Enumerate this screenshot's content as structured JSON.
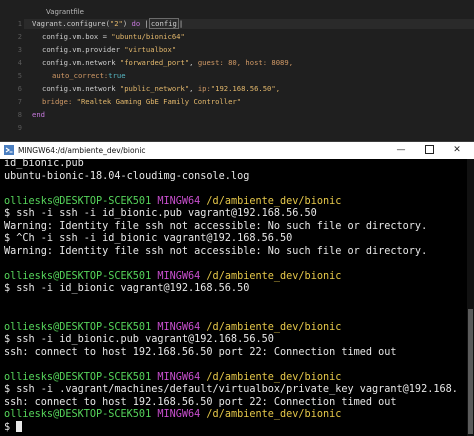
{
  "editor": {
    "tab_title": "Vagrantfile",
    "line_numbers": [
      "1",
      "2",
      "3",
      "4",
      "5",
      "6",
      "7",
      "8",
      "9"
    ],
    "lines": {
      "l1": [
        "Vagrant",
        ".configure(",
        "\"2\"",
        ") ",
        "do",
        " |",
        "config",
        "|"
      ],
      "l2": [
        "config",
        ".vm.box = ",
        "\"ubuntu/bionic64\""
      ],
      "l3": [
        "config",
        ".vm.provider ",
        "\"virtualbox\""
      ],
      "l4": [
        "config",
        ".vm.network ",
        "\"forwarded_port\"",
        ", ",
        "guest:",
        " 80, ",
        "host:",
        " 8089,"
      ],
      "l5": [
        "auto_correct:",
        "true"
      ],
      "l6": [
        "config",
        ".vm.network ",
        "\"public_network\"",
        ", ",
        "ip:",
        "\"192.168.56.50\","
      ],
      "l7": [
        "bridge:",
        " ",
        "\"Realtek Gaming GbE Family Controller\""
      ],
      "l8": [
        "end"
      ]
    }
  },
  "terminal": {
    "window_title": "MINGW64:/d/ambiente_dev/bionic",
    "minimize_glyph": "—",
    "close_glyph": "✕",
    "prompt": {
      "user": "olliesks@DESKTOP-SCEK501",
      "env": "MINGW64",
      "path": "/d/ambiente_dev/bionic"
    },
    "lines": {
      "o1": "id_bionic.pub",
      "o2": "ubuntu-bionic-18.04-cloudimg-console.log",
      "c1": "$ ssh -i ssh -i id_bionic.pub vagrant@192.168.56.50",
      "o3": "Warning: Identity file ssh not accessible: No such file or directory.",
      "c2": "$ ^Ch -i ssh -i id_bionic vagrant@192.168.56.50",
      "o4": "Warning: Identity file ssh not accessible: No such file or directory.",
      "c3": "$ ssh -i id_bionic vagrant@192.168.56.50",
      "c4": "$ ssh -i id_bionic.pub vagrant@192.168.56.50",
      "o5": "ssh: connect to host 192.168.56.50 port 22: Connection timed out",
      "c5": "$ ssh -i .vagrant/machines/default/virtualbox/private_key vagrant@192.168.",
      "o6": "ssh: connect to host 192.168.56.50 port 22: Connection timed out",
      "c6": "$ "
    }
  }
}
